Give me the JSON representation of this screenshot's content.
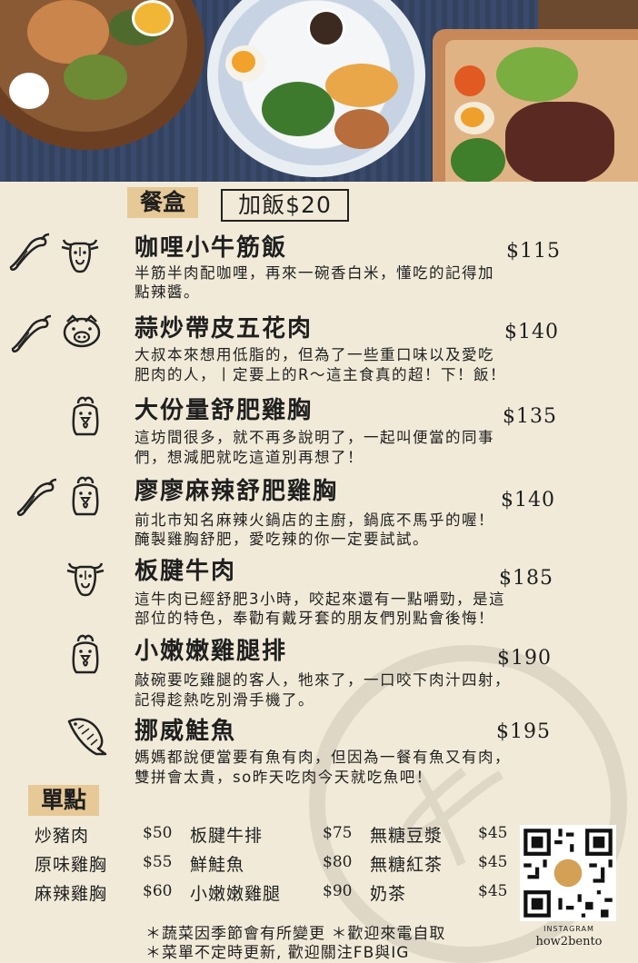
{
  "sections": {
    "bento_label": "餐盒",
    "addon_rice": "加飯$20",
    "alacarte_label": "單點"
  },
  "items": [
    {
      "name": "咖哩小牛筋飯",
      "price": "$115",
      "desc1": "半筋半肉配咖哩，再來一碗香白米，懂吃的記得加",
      "desc2": "點辣醬。"
    },
    {
      "name": "蒜炒帶皮五花肉",
      "price": "$140",
      "desc1": "大叔本來想用低脂的，但為了一些重口味以及愛吃",
      "desc2": "肥肉的人，丨定要上的R～這主食真的超！下！飯！"
    },
    {
      "name": "大份量舒肥雞胸",
      "price": "$135",
      "desc1": "這坊間很多，就不再多說明了，一起叫便當的同事",
      "desc2": "們，想減肥就吃這道別再想了！"
    },
    {
      "name": "廖廖麻辣舒肥雞胸",
      "price": "$140",
      "desc1": "前北市知名麻辣火鍋店的主廚，鍋底不馬乎的喔！",
      "desc2": "醃製雞胸舒肥，愛吃辣的你一定要試試。"
    },
    {
      "name": "板腱牛肉",
      "price": "$185",
      "desc1": "這牛肉已經舒肥3小時，咬起來還有一點嚼勁，是這",
      "desc2": "部位的特色，奉勸有戴牙套的朋友們別點會後悔！"
    },
    {
      "name": "小嫩嫩雞腿排",
      "price": "$190",
      "desc1": "敲碗要吃雞腿的客人，牠來了，一口咬下肉汁四射，",
      "desc2": "記得趁熱吃別滑手機了。"
    },
    {
      "name": "挪威鮭魚",
      "price": "$195",
      "desc1": "媽媽都說便當要有魚有肉，但因為一餐有魚又有肉，",
      "desc2": "雙拼會太貴，so昨天吃肉今天就吃魚吧！"
    }
  ],
  "alacarte": [
    {
      "name": "炒豬肉",
      "price": "$50"
    },
    {
      "name": "原味雞胸",
      "price": "$55"
    },
    {
      "name": "麻辣雞胸",
      "price": "$60"
    },
    {
      "name": "板腱牛排",
      "price": "$75"
    },
    {
      "name": "鮮鮭魚",
      "price": "$80"
    },
    {
      "name": "小嫩嫩雞腿",
      "price": "$90"
    },
    {
      "name": "無糖豆漿",
      "price": "$45"
    },
    {
      "name": "無糖紅茶",
      "price": "$45"
    },
    {
      "name": "奶茶",
      "price": "$45"
    }
  ],
  "notes": {
    "line1": "＊蔬菜因季節會有所變更 ＊歡迎來電自取",
    "line2": "＊菜單不定時更新, 歡迎關注FB與IG"
  },
  "qr": {
    "caption_top": "INSTAGRAM",
    "caption_bottom": "how2bento"
  },
  "colors": {
    "background": "#f1ead8",
    "tag_highlight": "#e6c996"
  },
  "icons": [
    "chili-icon",
    "cow-icon",
    "pig-icon",
    "chicken-icon",
    "fish-icon",
    "qr-code"
  ]
}
